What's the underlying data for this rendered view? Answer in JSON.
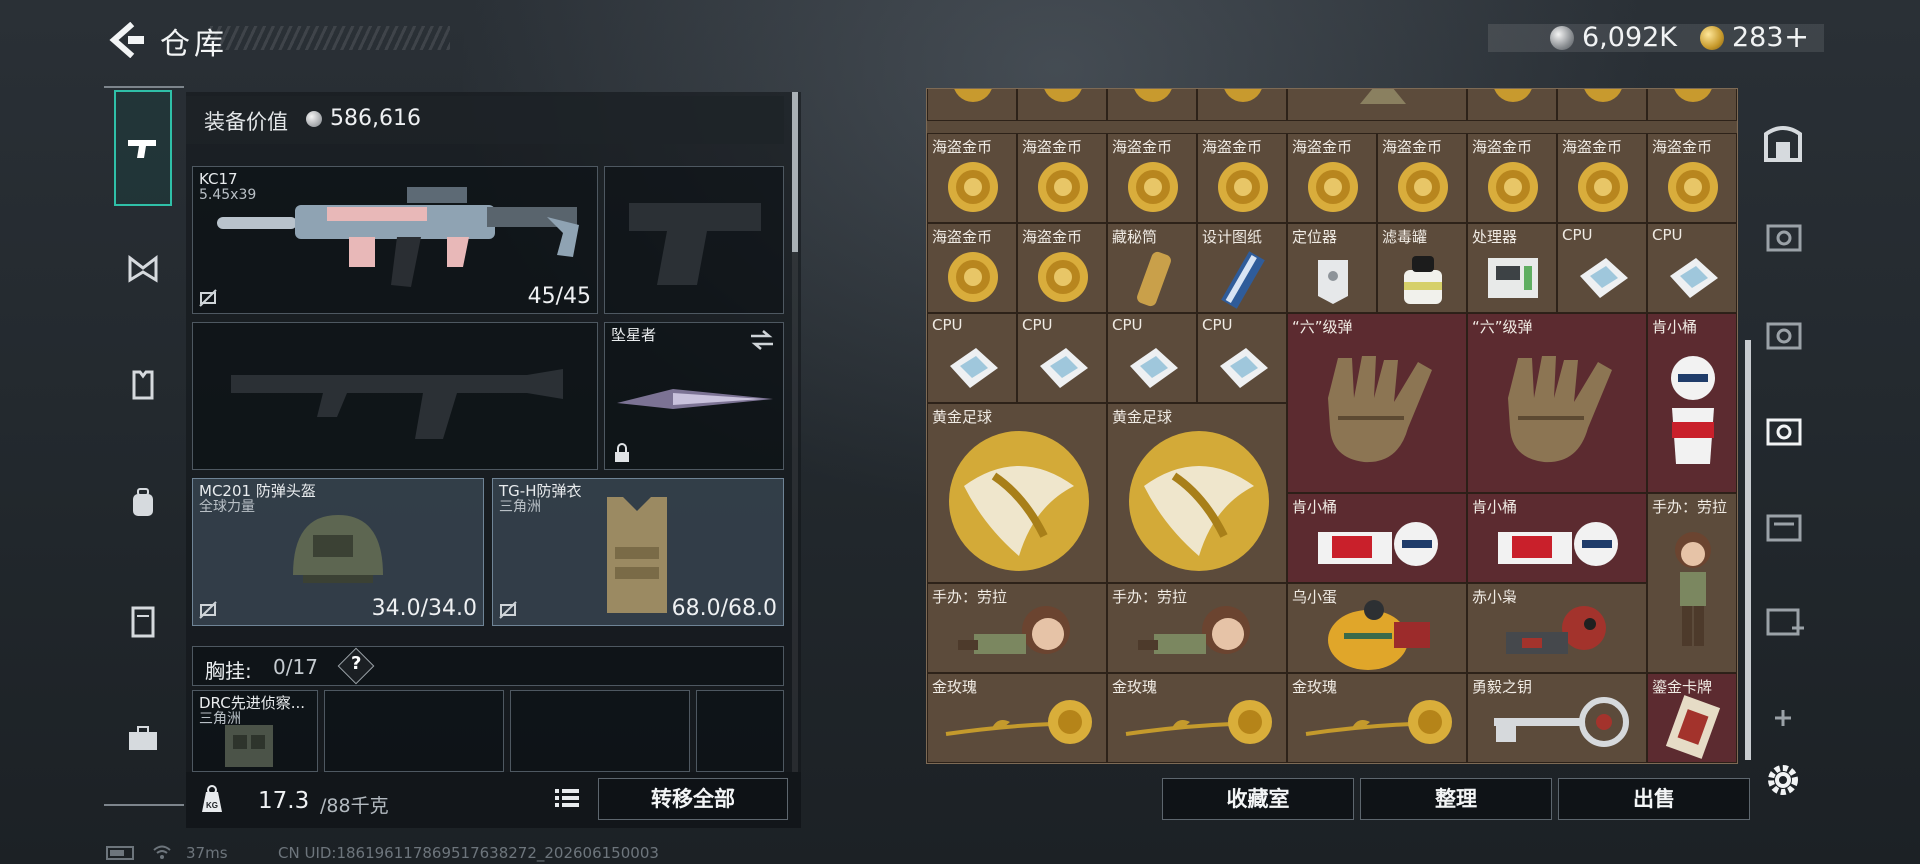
{
  "header": {
    "title": "仓库",
    "currency_silver": "6,092K",
    "currency_gold": "283",
    "plus_label": "+"
  },
  "rail": {
    "items": [
      {
        "name": "weapons",
        "icon": "pistol-icon"
      },
      {
        "name": "attachments",
        "icon": "bow-tie-icon"
      },
      {
        "name": "armor",
        "icon": "vest-icon"
      },
      {
        "name": "backpack",
        "icon": "backpack-icon"
      },
      {
        "name": "container",
        "icon": "locker-icon"
      },
      {
        "name": "cases",
        "icon": "briefcase-icon"
      }
    ]
  },
  "loadout": {
    "value_label": "装备价值",
    "value": "586,616",
    "primary": {
      "name": "KC17",
      "caliber": "5.45x39",
      "ammo": "45/45"
    },
    "melee": {
      "name": "坠星者"
    },
    "helmet": {
      "name": "MC201 防弹头盔",
      "faction": "全球力量",
      "durability": "34.0/34.0"
    },
    "armor": {
      "name": "TG-H防弹衣",
      "faction": "三角洲",
      "durability": "68.0/68.0"
    },
    "chest_rig": {
      "label": "胸挂:",
      "value": "0/17",
      "help": "?"
    },
    "backpack_item": {
      "name": "DRC先进侦察...",
      "faction": "三角洲"
    },
    "weight_value": "17.3",
    "weight_max": "/88千克",
    "transfer_all": "转移全部"
  },
  "grid": {
    "names": {
      "coin": "海盗金币",
      "secret_tube": "藏秘筒",
      "blueprint": "设计图纸",
      "locator": "定位器",
      "filter": "滤毒罐",
      "processor": "处理器",
      "cpu": "CPU",
      "grade_six_ammo": "“六”级弹",
      "kfc_bucket": "肯小桶",
      "gold_ball": "黄金足球",
      "figure_lara": "手办：劳拉",
      "crow_egg": "乌小蛋",
      "red_owl": "赤小枭",
      "gold_rose": "金玫瑰",
      "courage_key": "勇毅之钥",
      "gilded_card": "鎏金卡牌"
    }
  },
  "actions": {
    "collection": "收藏室",
    "sort": "整理",
    "sell": "出售"
  },
  "footer": {
    "ping": "37ms",
    "uid": "CN UID:1861961178695176382​72_202606150003"
  },
  "colors": {
    "accent": "#2fc0a8",
    "grid_bg": "#5c4b3b",
    "grid_red": "#5c2b30"
  }
}
